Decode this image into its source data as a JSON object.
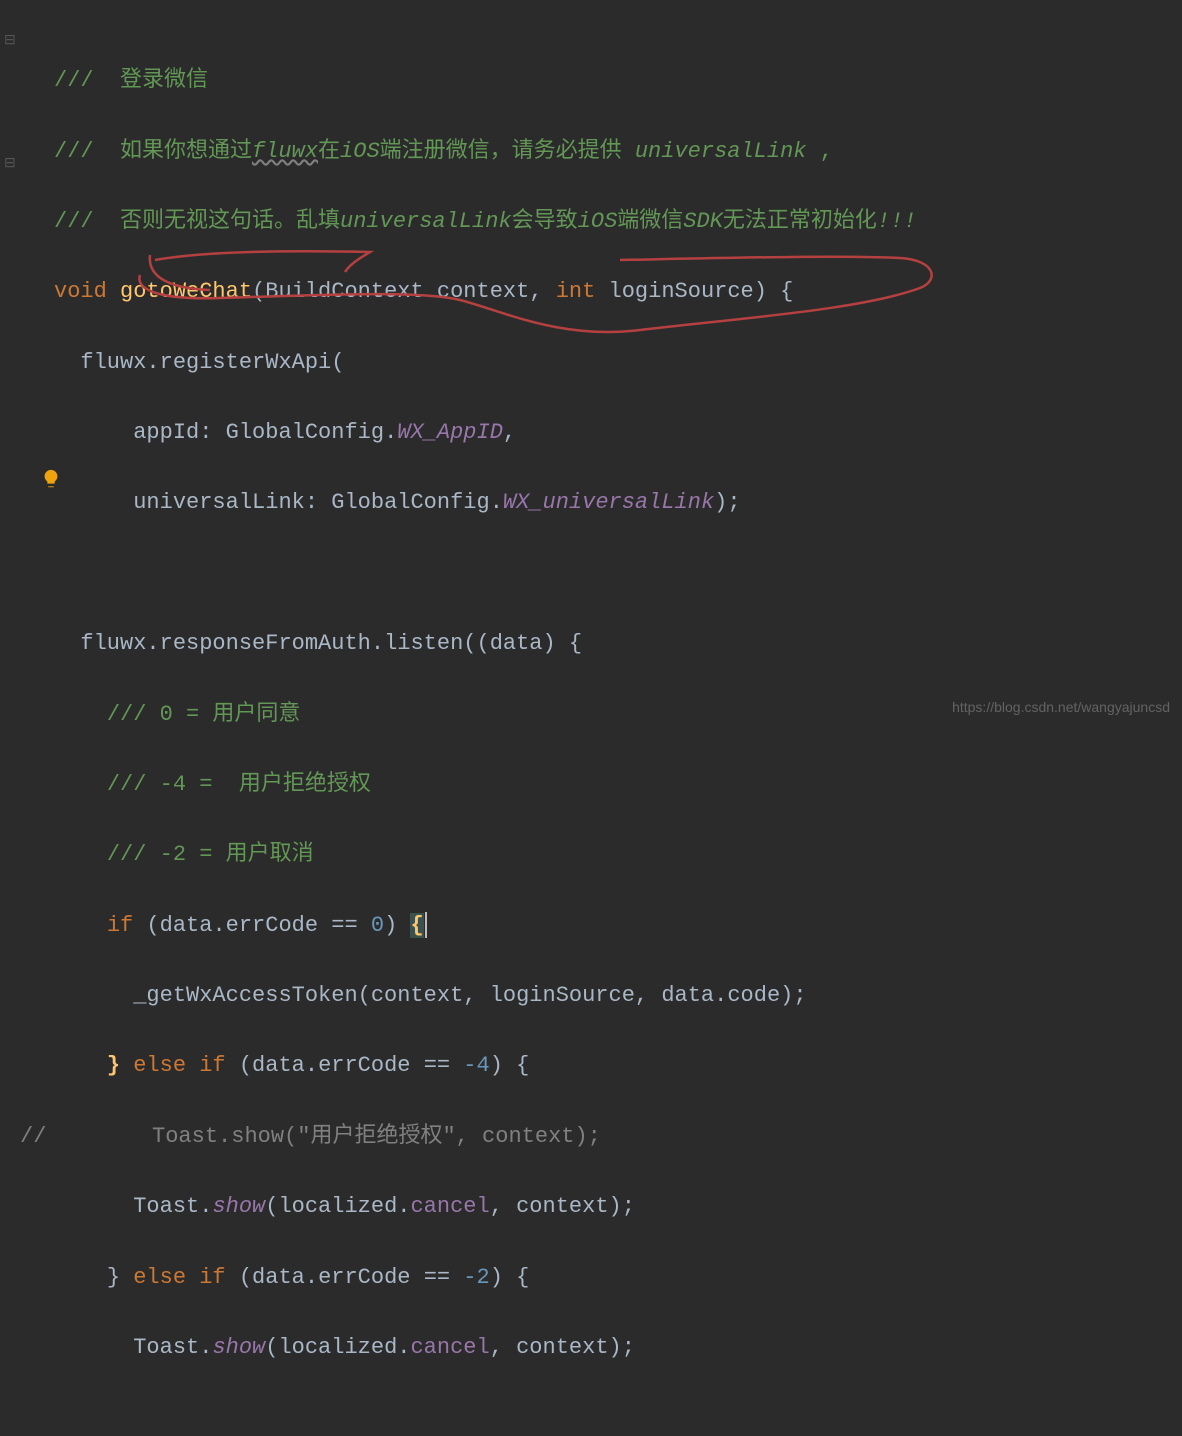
{
  "doc": {
    "c1": "///  登录微信",
    "c2a": "///  如果你想通过",
    "c2b": "fluwx",
    "c2c": "在",
    "c2d": "iOS",
    "c2e": "端注册微信，请务必提供 ",
    "c2f": "universalLink",
    "c2g": " ,",
    "c3a": "///  否则无视这句话。乱填",
    "c3b": "universalLink",
    "c3c": "会导致",
    "c3d": "iOS",
    "c3e": "端微信",
    "c3f": "SDK",
    "c3g": "无法正常初始化",
    "c3h": "!!!"
  },
  "sig": {
    "kw": "void",
    "fn": "gotoWeChat",
    "p1t": "BuildContext",
    "p1n": "context",
    "p2t": "int",
    "p2n": "loginSource"
  },
  "reg": {
    "obj": "fluwx",
    "call": "registerWxApi",
    "p1n": "appId",
    "p1v_obj": "GlobalConfig",
    "p1v_mem": "WX_AppID",
    "p2n": "universalLink",
    "p2v_obj": "GlobalConfig",
    "p2v_mem": "WX_universalLink"
  },
  "listen": {
    "obj": "fluwx",
    "prop": "responseFromAuth",
    "fn": "listen",
    "arg": "data"
  },
  "inner": {
    "c1": "/// 0 = 用户同意",
    "c2": "/// -4 =  用户拒绝授权",
    "c3": "/// -2 = 用户取消",
    "kw_if": "if",
    "cond1a": "data",
    "cond1b": "errCode",
    "eq": "==",
    "zero": "0",
    "call1": "_getWxAccessToken",
    "call1_a1": "context",
    "call1_a2": "loginSource",
    "call1_a3a": "data",
    "call1_a3b": "code",
    "kw_else": "else",
    "neg4": "-4",
    "commented_prefix": "//",
    "commented": "        Toast.show(\"用户拒绝授权\", context);",
    "toast_obj": "Toast",
    "toast_show": "show",
    "loc_obj": "localized",
    "loc_mem": "cancel",
    "ctx": "context",
    "neg2": "-2"
  },
  "watermark": "https://blog.csdn.net/wangyajuncsd"
}
